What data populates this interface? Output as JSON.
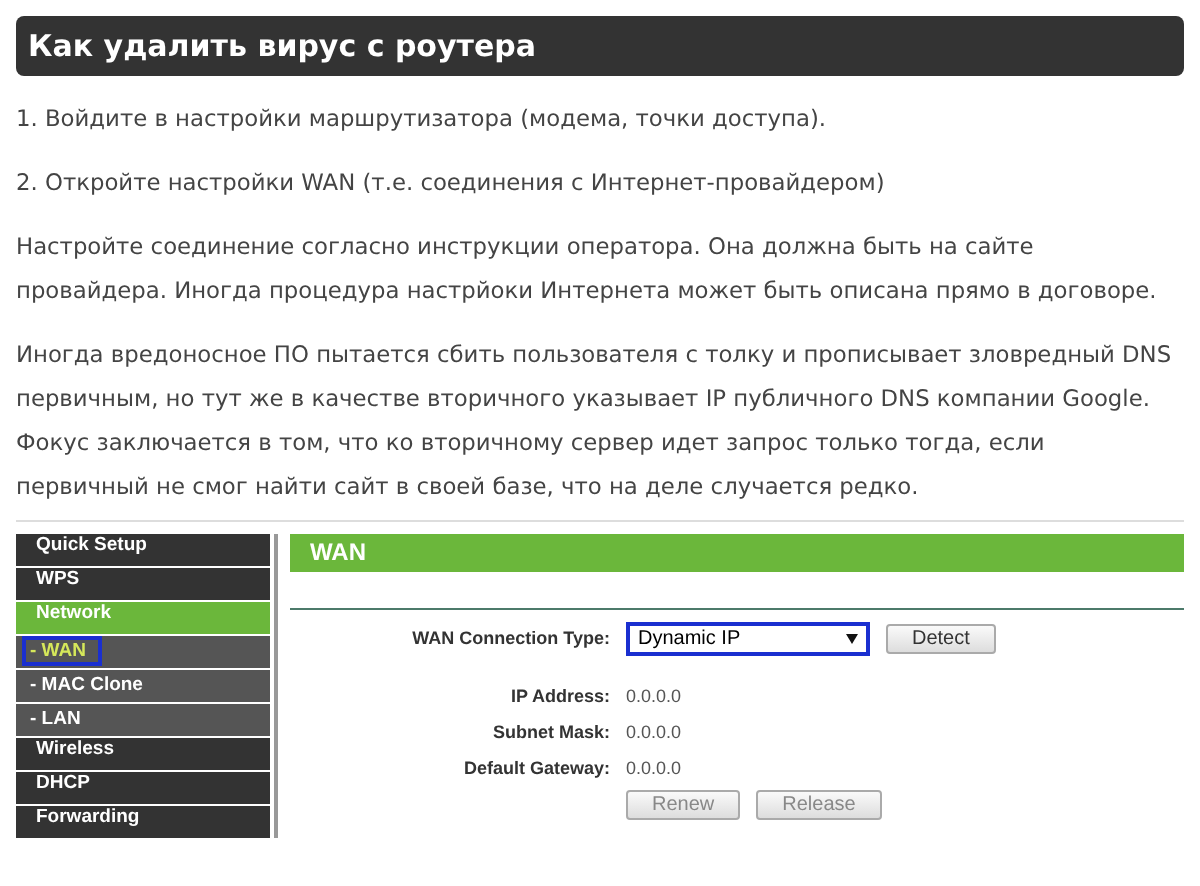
{
  "heading": "Как удалить вирус с роутера",
  "paragraphs": [
    "1. Войдите в настройки маршрутизатора (модема, точки доступа).",
    "2. Откройте настройки WAN (т.е. соединения с Интернет-провайдером)",
    "Настройте соединение согласно инструкции оператора. Она должна быть на сайте провайдера. Иногда процедура настрйоки Интернета может быть описана прямо в договоре.",
    "Иногда вредоносное ПО пытается сбить пользователя с толку и прописывает зловредный DNS первичным, но тут же в качестве вторичного указывает IP публичного DNS компании Google. Фокус заключается в том, что ко вторичному сервер идет запрос только тогда, если первичный не смог найти сайт в своей базе, что на деле случается редко."
  ],
  "router": {
    "sidebar": [
      {
        "label": "Quick Setup",
        "expanded": false
      },
      {
        "label": "WPS",
        "expanded": false
      },
      {
        "label": "Network",
        "expanded": true,
        "children": [
          {
            "label": "- WAN",
            "selected": true
          },
          {
            "label": "- MAC Clone",
            "selected": false
          },
          {
            "label": "- LAN",
            "selected": false
          }
        ]
      },
      {
        "label": "Wireless",
        "expanded": false
      },
      {
        "label": "DHCP",
        "expanded": false
      },
      {
        "label": "Forwarding",
        "expanded": false
      }
    ],
    "panel_title": "WAN",
    "connection_type": {
      "label": "WAN Connection Type:",
      "value": "Dynamic IP"
    },
    "detect_button": "Detect",
    "fields": [
      {
        "label": "IP Address:",
        "value": "0.0.0.0"
      },
      {
        "label": "Subnet Mask:",
        "value": "0.0.0.0"
      },
      {
        "label": "Default Gateway:",
        "value": "0.0.0.0"
      }
    ],
    "buttons": [
      {
        "label": "Renew",
        "disabled": true
      },
      {
        "label": "Release",
        "disabled": true
      }
    ]
  }
}
